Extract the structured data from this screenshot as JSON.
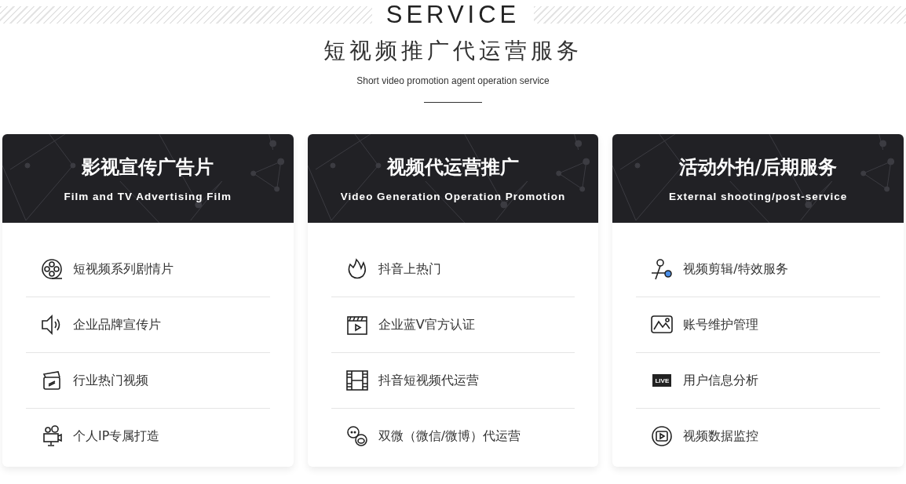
{
  "heading": {
    "title": "SERVICE",
    "subtitle": "短视频推广代运营服务",
    "caption": "Short video promotion agent operation service"
  },
  "cards": [
    {
      "title": "影视宣传广告片",
      "subtitle": "Film and TV Advertising Film",
      "items": [
        {
          "kind": "reel",
          "label": "短视频系列剧情片"
        },
        {
          "kind": "speaker",
          "label": "企业品牌宣传片"
        },
        {
          "kind": "cards",
          "label": "行业热门视频"
        },
        {
          "kind": "camera",
          "label": "个人IP专属打造"
        }
      ]
    },
    {
      "title": "视频代运营推广",
      "subtitle": "Video Generation Operation Promotion",
      "items": [
        {
          "kind": "flame",
          "label": "抖音上热门"
        },
        {
          "kind": "clapper",
          "label": "企业蓝V官方认证"
        },
        {
          "kind": "filmstrip",
          "label": "抖音短视频代运营"
        },
        {
          "kind": "social",
          "label": "双微（微信/微博）代运营"
        }
      ]
    },
    {
      "title": "活动外拍/后期服务",
      "subtitle": "External shooting/post-service",
      "items": [
        {
          "kind": "scissors",
          "label": "视频剪辑/特效服务"
        },
        {
          "kind": "image",
          "label": "账号维护管理"
        },
        {
          "kind": "live",
          "badge": "LIVE",
          "label": "用户信息分析"
        },
        {
          "kind": "player",
          "label": "视频数据监控"
        }
      ]
    }
  ]
}
